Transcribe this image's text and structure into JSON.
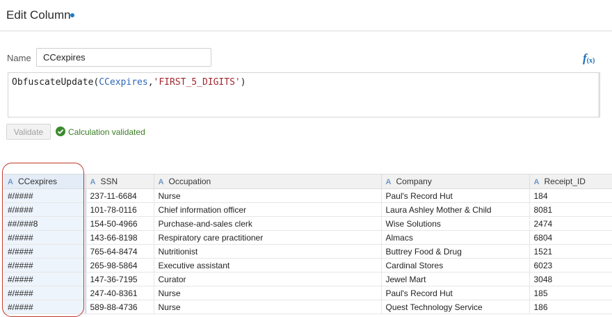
{
  "header": {
    "title": "Edit Column"
  },
  "form": {
    "name_label": "Name",
    "name_value": "CCexpires",
    "fx_label": "f",
    "fx_sub": "(x)"
  },
  "expression": {
    "fn": "ObfuscateUpdate(",
    "col": "CCexpires",
    "sep": ",",
    "str": "'FIRST_5_DIGITS'",
    "close": ")"
  },
  "validation": {
    "button_label": "Validate",
    "status": "Calculation validated",
    "status_color": "#3b7d24"
  },
  "grid": {
    "type_icon": "A",
    "columns": [
      "CCexpires",
      "SSN",
      "Occupation",
      "Company",
      "Receipt_ID"
    ],
    "selected_column": "CCexpires",
    "rows": [
      [
        "#/####",
        "237-11-6684",
        "Nurse",
        "Paul's Record Hut",
        "184"
      ],
      [
        "#/####",
        "101-78-0116",
        "Chief information officer",
        "Laura Ashley Mother & Child",
        "8081"
      ],
      [
        "##/###8",
        "154-50-4966",
        "Purchase-and-sales clerk",
        "Wise Solutions",
        "2474"
      ],
      [
        "#/####",
        "143-66-8198",
        "Respiratory care practitioner",
        "Almacs",
        "6804"
      ],
      [
        "#/####",
        "765-64-8474",
        "Nutritionist",
        "Buttrey Food & Drug",
        "1521"
      ],
      [
        "#/####",
        "265-98-5864",
        "Executive assistant",
        "Cardinal Stores",
        "6023"
      ],
      [
        "#/####",
        "147-36-7195",
        "Curator",
        "Jewel Mart",
        "3048"
      ],
      [
        "#/####",
        "247-40-8361",
        "Nurse",
        "Paul's Record Hut",
        "185"
      ],
      [
        "#/####",
        "589-88-4736",
        "Nurse",
        "Quest Technology Service",
        "186"
      ]
    ]
  },
  "colors": {
    "accent": "#1a7ccb",
    "highlight": "#c0392b",
    "success": "#3c8a2e"
  }
}
